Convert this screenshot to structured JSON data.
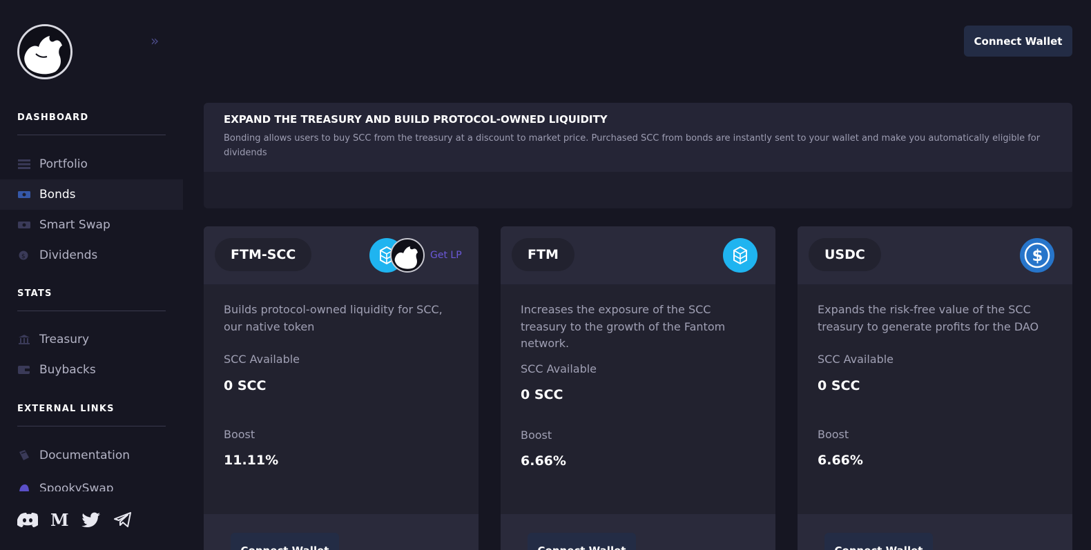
{
  "header": {
    "connect_label": "Connect Wallet"
  },
  "sidebar": {
    "sections": {
      "dashboard": "DASHBOARD",
      "stats": "STATS",
      "external": "EXTERNAL LINKS"
    },
    "items": [
      {
        "label": "Portfolio",
        "icon": "portfolio-icon"
      },
      {
        "label": "Bonds",
        "icon": "bonds-icon",
        "active": true
      },
      {
        "label": "Smart Swap",
        "icon": "smart-swap-icon"
      },
      {
        "label": "Dividends",
        "icon": "dividends-icon"
      },
      {
        "label": "Treasury",
        "icon": "treasury-icon"
      },
      {
        "label": "Buybacks",
        "icon": "buybacks-icon"
      },
      {
        "label": "Documentation",
        "icon": "documentation-icon"
      },
      {
        "label": "SpookySwap",
        "icon": "spookyswap-icon"
      }
    ],
    "socials": [
      "discord-icon",
      "medium-icon",
      "twitter-icon",
      "telegram-icon"
    ]
  },
  "banner": {
    "title": "EXPAND THE TREASURY AND BUILD PROTOCOL-OWNED LIQUIDITY",
    "text": "Bonding allows users to buy SCC from the treasury at a discount to market price. Purchased SCC from bonds are instantly sent to your wallet and make you automatically eligible for dividends"
  },
  "cards": [
    {
      "name": "FTM-SCC",
      "get_lp": "Get LP",
      "description": "Builds protocol-owned liquidity for SCC, our native token",
      "available_label": "SCC Available",
      "available_value": "0 SCC",
      "boost_label": "Boost",
      "boost_value": "11.11%",
      "connect_label": "Connect Wallet"
    },
    {
      "name": "FTM",
      "description": "Increases the exposure of the SCC treasury to the growth of the Fantom network.",
      "available_label": "SCC Available",
      "available_value": "0 SCC",
      "boost_label": "Boost",
      "boost_value": "6.66%",
      "connect_label": "Connect Wallet"
    },
    {
      "name": "USDC",
      "description": "Expands the risk-free value of the SCC treasury to generate profits for the DAO",
      "available_label": "SCC Available",
      "available_value": "0 SCC",
      "boost_label": "Boost",
      "boost_value": "6.66%",
      "connect_label": "Connect Wallet"
    }
  ],
  "colors": {
    "background": "#161622",
    "card": "#22222f",
    "card_header": "#2a2a3b",
    "button": "#232c45",
    "fantom_blue": "#1fb4f0",
    "usdc_blue": "#2775ca",
    "get_lp": "#6b58d8"
  }
}
